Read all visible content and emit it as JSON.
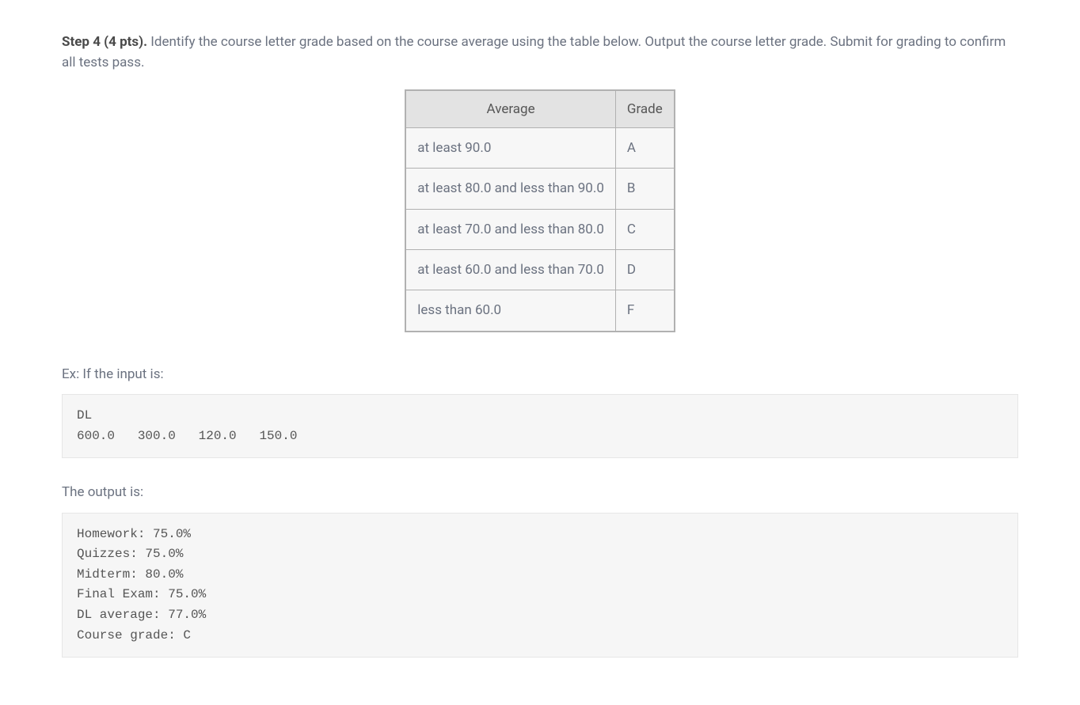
{
  "step": {
    "bold_label": "Step 4 (4 pts).",
    "description": " Identify the course letter grade based on the course average using the table below. Output the course letter grade. Submit for grading to confirm all tests pass."
  },
  "table": {
    "headers": [
      "Average",
      "Grade"
    ],
    "rows": [
      {
        "avg": "at least 90.0",
        "grade": "A"
      },
      {
        "avg": "at least 80.0 and less than 90.0",
        "grade": "B"
      },
      {
        "avg": "at least 70.0 and less than 80.0",
        "grade": "C"
      },
      {
        "avg": "at least 60.0 and less than 70.0",
        "grade": "D"
      },
      {
        "avg": "less than 60.0",
        "grade": "F"
      }
    ]
  },
  "example": {
    "input_label": "Ex: If the input is:",
    "input_code": "DL\n600.0   300.0   120.0   150.0",
    "output_label": "The output is:",
    "output_code": "Homework: 75.0%\nQuizzes: 75.0%\nMidterm: 80.0%\nFinal Exam: 75.0%\nDL average: 77.0%\nCourse grade: C"
  }
}
